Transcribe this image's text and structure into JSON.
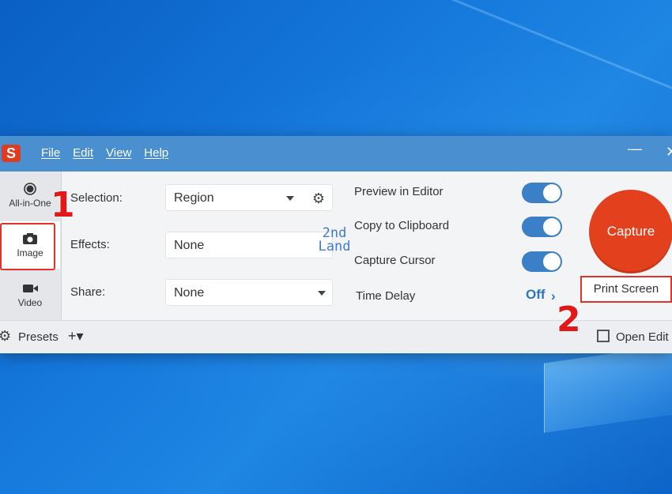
{
  "colors": {
    "titlebar": "#4a8fd0",
    "capture": "#e3401e",
    "toggle_on": "#3b7fc7",
    "annotation": "#e31818"
  },
  "menu": [
    "File",
    "Edit",
    "View",
    "Help"
  ],
  "window_controls": {
    "minimize": "—",
    "close": "✕"
  },
  "modes": {
    "all_in_one": "All-in-One",
    "image": "Image",
    "video": "Video"
  },
  "fields": {
    "selection": {
      "label": "Selection:",
      "value": "Region"
    },
    "effects": {
      "label": "Effects:",
      "value": "None"
    },
    "share": {
      "label": "Share:",
      "value": "None"
    }
  },
  "options": {
    "preview": "Preview in Editor",
    "clipboard": "Copy to Clipboard",
    "cursor": "Capture Cursor",
    "time_delay": "Time Delay",
    "time_delay_value": "Off"
  },
  "capture": {
    "label": "Capture",
    "hotkey": "Print Screen"
  },
  "bottom": {
    "presets": "Presets",
    "add": "+▾",
    "open_editor": "Open Edit"
  },
  "annotations": {
    "one": "1",
    "two": "2"
  },
  "watermark": {
    "line1": "2nd",
    "line2": "Land"
  }
}
